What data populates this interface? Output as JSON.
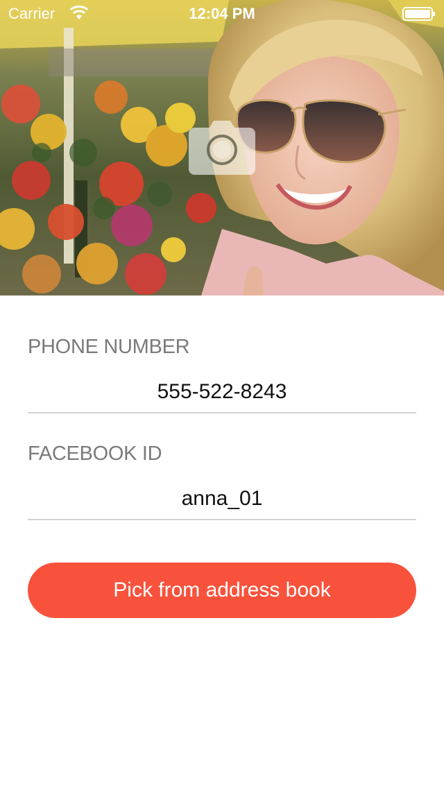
{
  "status_bar": {
    "carrier": "Carrier",
    "time": "12:04 PM",
    "wifi_icon": "wifi-icon",
    "battery_icon": "battery-icon"
  },
  "hero": {
    "photo": "profile-photo",
    "camera_icon": "camera-icon"
  },
  "form": {
    "phone": {
      "label": "PHONE NUMBER",
      "value": "555-522-8243"
    },
    "facebook": {
      "label": "FACEBOOK ID",
      "value": "anna_01"
    }
  },
  "actions": {
    "pick_label": "Pick from address book"
  },
  "colors": {
    "accent": "#f9523c",
    "label": "#7a7a7a",
    "divider": "#d4d4d4"
  }
}
